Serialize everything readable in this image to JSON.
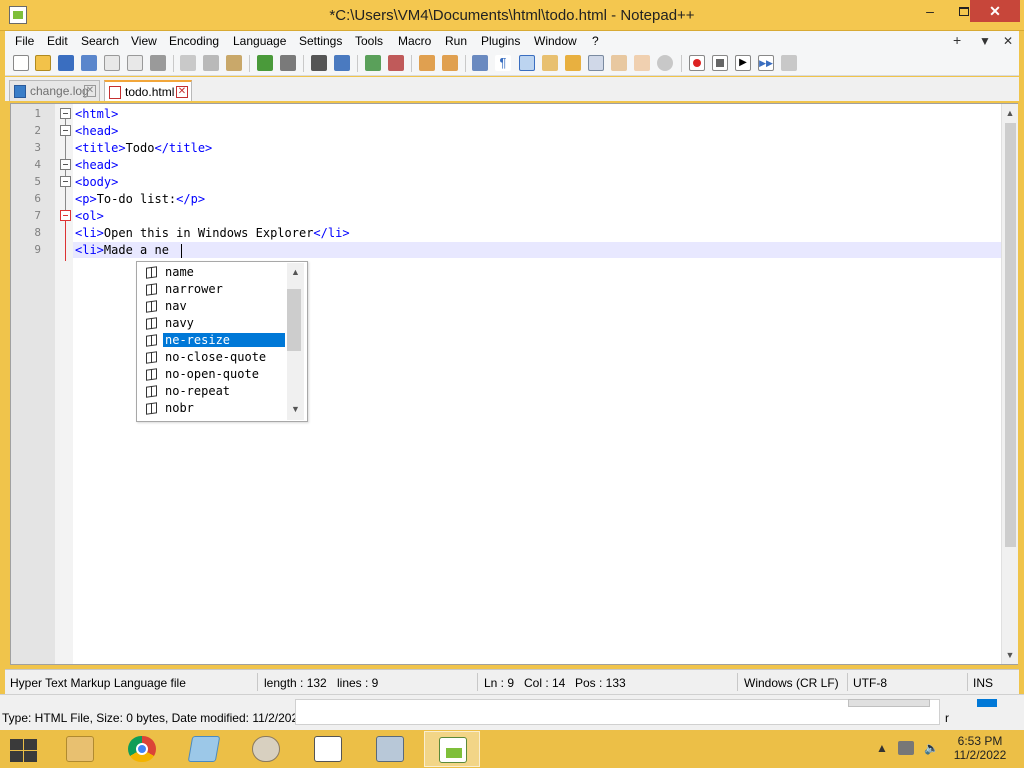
{
  "window": {
    "title": "*C:\\Users\\VM4\\Documents\\html\\todo.html - Notepad++",
    "minimize_glyph": "–",
    "close_glyph": "✕"
  },
  "menu": {
    "items": [
      "File",
      "Edit",
      "Search",
      "View",
      "Encoding",
      "Language",
      "Settings",
      "Tools",
      "Macro",
      "Run",
      "Plugins",
      "Window",
      "?"
    ],
    "right_items": [
      "+",
      "▼",
      "✕"
    ]
  },
  "tabs": [
    {
      "label": "change.log",
      "active": false
    },
    {
      "label": "todo.html",
      "active": true
    }
  ],
  "editor": {
    "line_numbers": [
      "1",
      "2",
      "3",
      "4",
      "5",
      "6",
      "7",
      "8",
      "9"
    ],
    "lines": [
      {
        "tag1": "<html>",
        "text": "",
        "tag2": ""
      },
      {
        "tag1": "<head>",
        "text": "",
        "tag2": ""
      },
      {
        "tag1": "<title>",
        "text": "Todo",
        "tag2": "</title>"
      },
      {
        "tag1": "<head>",
        "text": "",
        "tag2": ""
      },
      {
        "tag1": "<body>",
        "text": "",
        "tag2": ""
      },
      {
        "tag1": "<p>",
        "text": "To-do list:",
        "tag2": "</p>"
      },
      {
        "tag1": "<ol>",
        "text": "",
        "tag2": ""
      },
      {
        "tag1": "<li>",
        "text": "Open this in Windows Explorer",
        "tag2": "</li>"
      },
      {
        "tag1": "<li>",
        "text": "Made a ne",
        "tag2": ""
      }
    ],
    "current_line": 9
  },
  "autocomplete": {
    "items": [
      "name",
      "narrower",
      "nav",
      "navy",
      "ne-resize",
      "no-close-quote",
      "no-open-quote",
      "no-repeat",
      "nobr"
    ],
    "selected": "ne-resize"
  },
  "statusbar": {
    "file_type": "Hyper Text Markup Language file",
    "length": "length : 132",
    "lines": "lines : 9",
    "ln": "Ln : 9",
    "col": "Col : 14",
    "pos": "Pos : 133",
    "eol": "Windows (CR LF)",
    "encoding": "UTF-8",
    "mode": "INS"
  },
  "background_window": {
    "info": "Type: HTML File, Size: 0 bytes, Date modified: 11/2/202",
    "fragment": "r"
  },
  "taskbar": {
    "time": "6:53 PM",
    "date": "11/2/2022"
  },
  "colors": {
    "titlebar": "#f4c74f",
    "taskbar": "#ecbf47",
    "selection": "#0078d7",
    "tag": "#0000ff",
    "fold_marker_active": "#dd3333"
  }
}
